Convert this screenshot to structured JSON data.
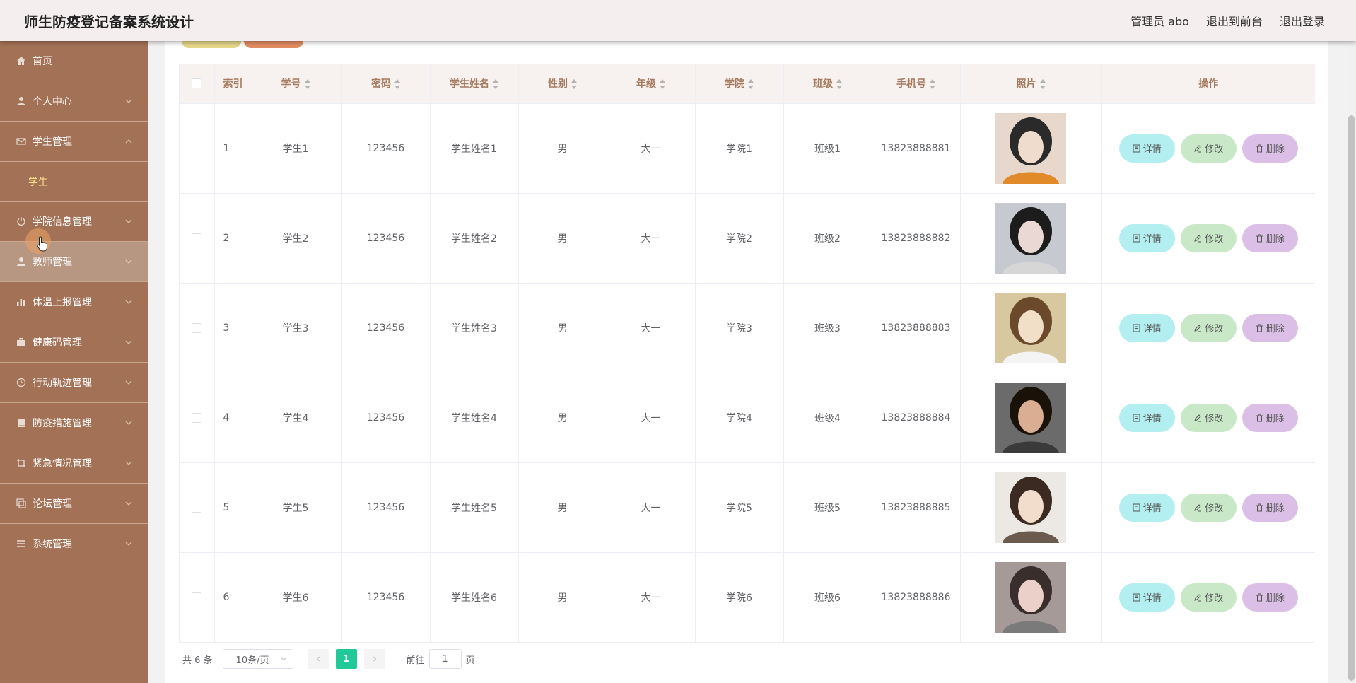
{
  "header": {
    "title": "师生防疫登记备案系统设计",
    "user": "管理员 abo",
    "to_front": "退出到前台",
    "logout": "退出登录"
  },
  "sidebar": {
    "items": [
      {
        "label": "首页",
        "icon": "home-icon"
      },
      {
        "label": "个人中心",
        "icon": "user-icon"
      },
      {
        "label": "学生管理",
        "icon": "envelope-icon",
        "expanded": true,
        "sub": [
          "学生"
        ]
      },
      {
        "label": "学院信息管理",
        "icon": "power-icon"
      },
      {
        "label": "教师管理",
        "icon": "user-icon"
      },
      {
        "label": "体温上报管理",
        "icon": "chart-icon"
      },
      {
        "label": "健康码管理",
        "icon": "briefcase-icon"
      },
      {
        "label": "行动轨迹管理",
        "icon": "clock-icon"
      },
      {
        "label": "防疫措施管理",
        "icon": "book-icon"
      },
      {
        "label": "紧急情况管理",
        "icon": "crop-icon"
      },
      {
        "label": "论坛管理",
        "icon": "copy-icon"
      },
      {
        "label": "系统管理",
        "icon": "list-icon"
      }
    ]
  },
  "table": {
    "headers": [
      "索引",
      "学号",
      "密码",
      "学生姓名",
      "性别",
      "年级",
      "学院",
      "班级",
      "手机号",
      "照片",
      "操作"
    ],
    "rows": [
      {
        "idx": "1",
        "no": "学生1",
        "pwd": "123456",
        "name": "学生姓名1",
        "sex": "男",
        "grade": "大一",
        "college": "学院1",
        "cls": "班级1",
        "phone": "13823888881"
      },
      {
        "idx": "2",
        "no": "学生2",
        "pwd": "123456",
        "name": "学生姓名2",
        "sex": "男",
        "grade": "大一",
        "college": "学院2",
        "cls": "班级2",
        "phone": "13823888882"
      },
      {
        "idx": "3",
        "no": "学生3",
        "pwd": "123456",
        "name": "学生姓名3",
        "sex": "男",
        "grade": "大一",
        "college": "学院3",
        "cls": "班级3",
        "phone": "13823888883"
      },
      {
        "idx": "4",
        "no": "学生4",
        "pwd": "123456",
        "name": "学生姓名4",
        "sex": "男",
        "grade": "大一",
        "college": "学院4",
        "cls": "班级4",
        "phone": "13823888884"
      },
      {
        "idx": "5",
        "no": "学生5",
        "pwd": "123456",
        "name": "学生姓名5",
        "sex": "男",
        "grade": "大一",
        "college": "学院5",
        "cls": "班级5",
        "phone": "13823888885"
      },
      {
        "idx": "6",
        "no": "学生6",
        "pwd": "123456",
        "name": "学生姓名6",
        "sex": "男",
        "grade": "大一",
        "college": "学院6",
        "cls": "班级6",
        "phone": "13823888886"
      }
    ],
    "btn_detail": "详情",
    "btn_edit": "修改",
    "btn_delete": "删除"
  },
  "pager": {
    "total": "共 6 条",
    "size": "10条/页",
    "current": "1",
    "goto_label": "前往",
    "goto_value": "1",
    "page_suffix": "页"
  },
  "colors": {
    "sidebar": "#a37256",
    "header": "#f4eeee",
    "accent": "#20c997"
  }
}
